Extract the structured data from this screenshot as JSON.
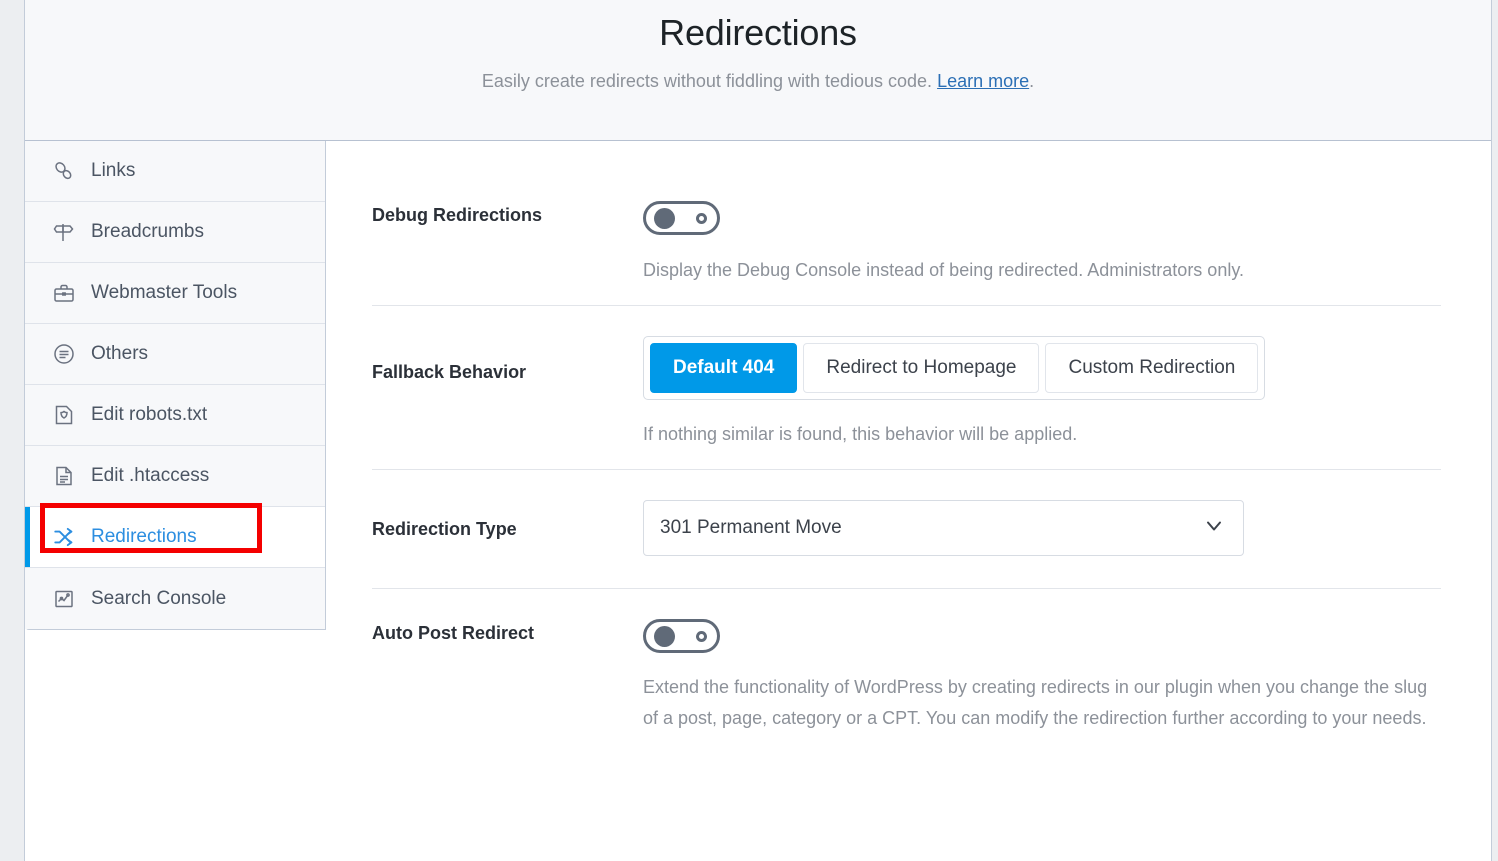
{
  "header": {
    "title": "Redirections",
    "subtitle_before": "Easily create redirects without fiddling with tedious code.",
    "learn_more": "Learn more",
    "subtitle_after": "."
  },
  "sidebar": {
    "items": [
      {
        "label": "Links",
        "icon": "link-icon",
        "active": false
      },
      {
        "label": "Breadcrumbs",
        "icon": "signpost-icon",
        "active": false
      },
      {
        "label": "Webmaster Tools",
        "icon": "toolbox-icon",
        "active": false
      },
      {
        "label": "Others",
        "icon": "list-circle-icon",
        "active": false
      },
      {
        "label": "Edit robots.txt",
        "icon": "shield-file-icon",
        "active": false
      },
      {
        "label": "Edit .htaccess",
        "icon": "document-lines-icon",
        "active": false
      },
      {
        "label": "Redirections",
        "icon": "shuffle-arrows-icon",
        "active": true
      },
      {
        "label": "Search Console",
        "icon": "analytics-chart-icon",
        "active": false
      }
    ]
  },
  "settings": {
    "debug_redirections": {
      "label": "Debug Redirections",
      "toggle_state": "off",
      "help": "Display the Debug Console instead of being redirected. Administrators only."
    },
    "fallback_behavior": {
      "label": "Fallback Behavior",
      "options": [
        {
          "label": "Default 404",
          "selected": true
        },
        {
          "label": "Redirect to Homepage",
          "selected": false
        },
        {
          "label": "Custom Redirection",
          "selected": false
        }
      ],
      "help": "If nothing similar is found, this behavior will be applied."
    },
    "redirection_type": {
      "label": "Redirection Type",
      "value": "301 Permanent Move"
    },
    "auto_post_redirect": {
      "label": "Auto Post Redirect",
      "toggle_state": "off",
      "help": "Extend the functionality of WordPress by creating redirects in our plugin when you change the slug of a post, page, category or a CPT. You can modify the redirection further according to your needs."
    }
  },
  "colors": {
    "accent": "#0099e8",
    "annotation": "#f40000",
    "link": "#2b6fb5",
    "muted_text": "#8c9199"
  }
}
